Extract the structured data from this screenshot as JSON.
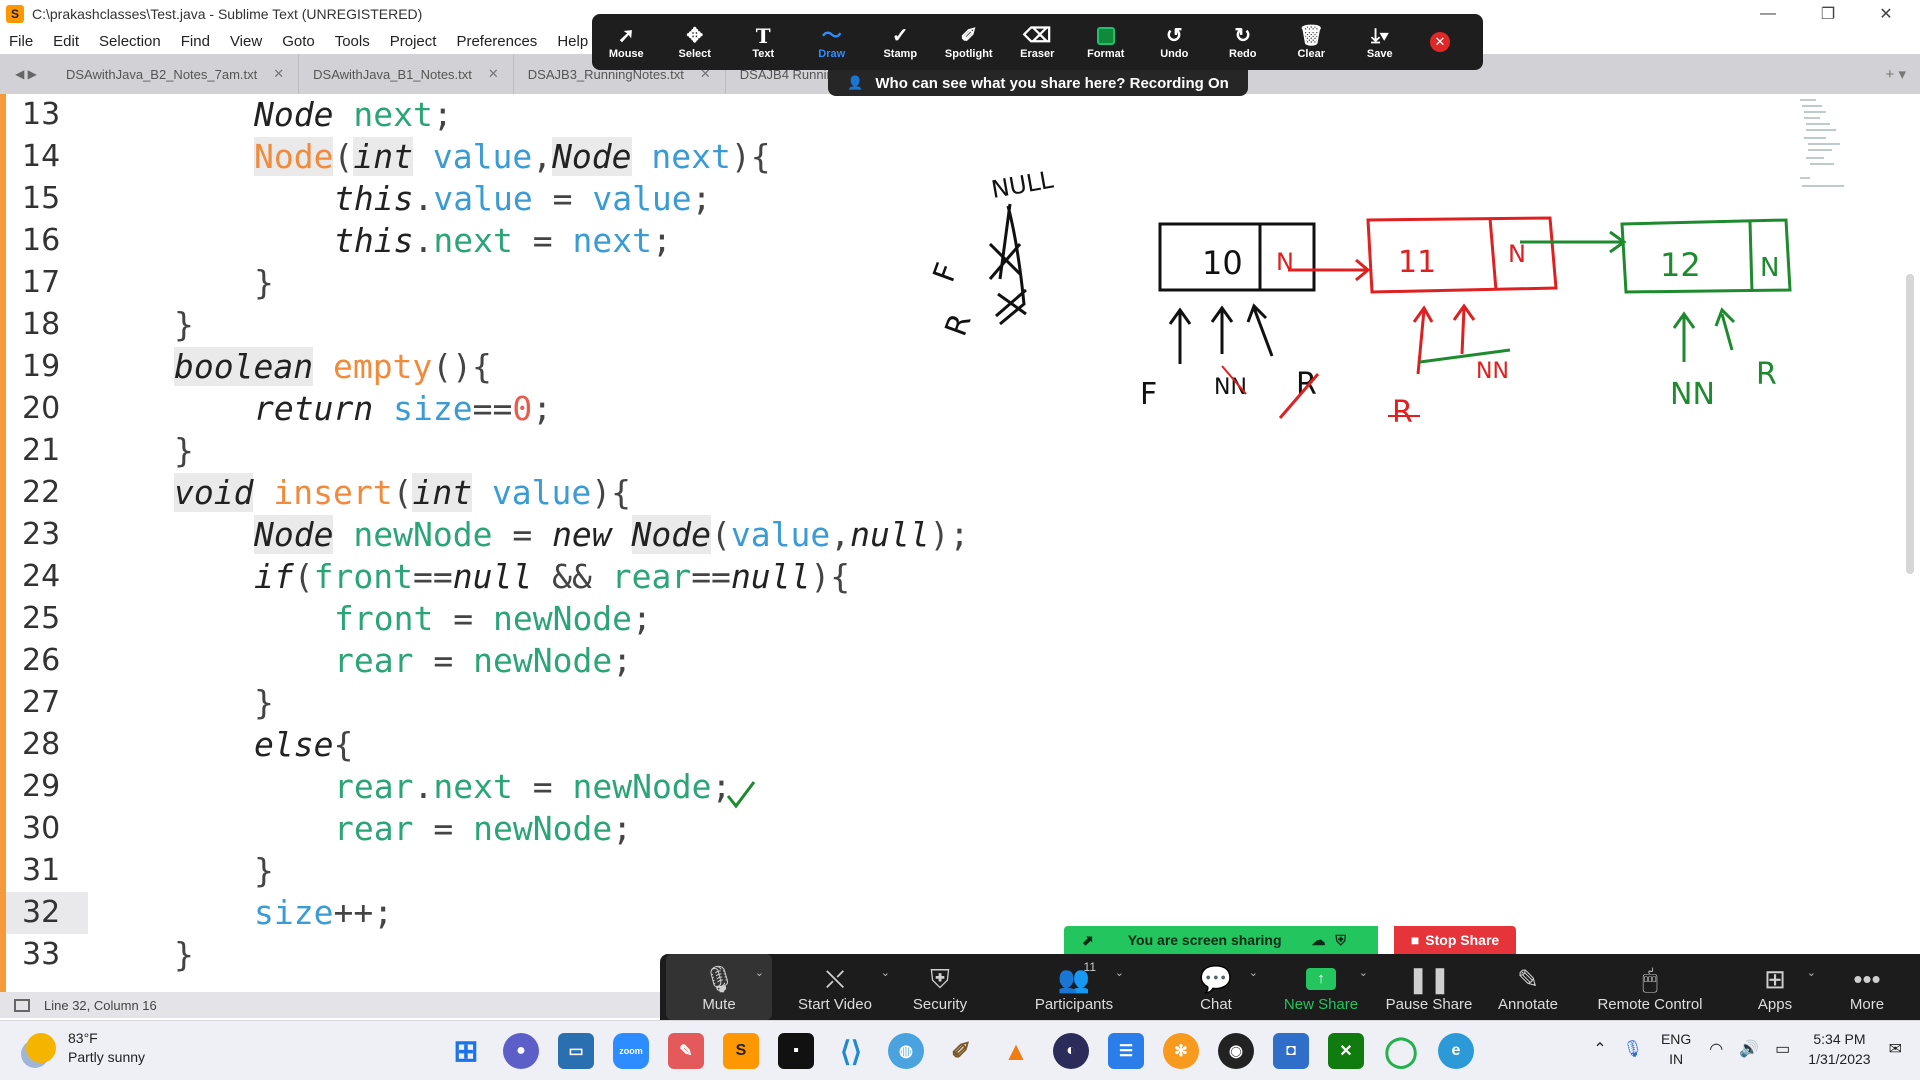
{
  "window": {
    "title": "C:\\prakashclasses\\Test.java - Sublime Text (UNREGISTERED)",
    "controls": [
      "—",
      "❐",
      "✕"
    ]
  },
  "menu": [
    "File",
    "Edit",
    "Selection",
    "Find",
    "View",
    "Goto",
    "Tools",
    "Project",
    "Preferences",
    "Help"
  ],
  "tabs": [
    {
      "label": "DSAwithJava_B2_Notes_7am.txt"
    },
    {
      "label": "DSAwithJava_B1_Notes.txt"
    },
    {
      "label": "DSAJB3_RunningNotes.txt"
    },
    {
      "label": "DSAJB4 Runnin"
    }
  ],
  "code_lines": [
    {
      "num": "13"
    },
    {
      "num": "14"
    },
    {
      "num": "15"
    },
    {
      "num": "16"
    },
    {
      "num": "17"
    },
    {
      "num": "18"
    },
    {
      "num": "19"
    },
    {
      "num": "20"
    },
    {
      "num": "21"
    },
    {
      "num": "22"
    },
    {
      "num": "23"
    },
    {
      "num": "24"
    },
    {
      "num": "25"
    },
    {
      "num": "26"
    },
    {
      "num": "27"
    },
    {
      "num": "28"
    },
    {
      "num": "29"
    },
    {
      "num": "30"
    },
    {
      "num": "31"
    },
    {
      "num": "32"
    },
    {
      "num": "33"
    }
  ],
  "status": {
    "position": "Line 32, Column 16"
  },
  "annotate_toolbar": {
    "tools": [
      "Mouse",
      "Select",
      "Text",
      "Draw",
      "Stamp",
      "Spotlight",
      "Eraser",
      "Format",
      "Undo",
      "Redo",
      "Clear",
      "Save"
    ],
    "active": "Draw",
    "recording_banner": "Who can see what you share here? Recording On"
  },
  "share": {
    "status": "You are screen sharing",
    "stop_label": "Stop Share"
  },
  "zoom_toolbar": {
    "mute": "Mute",
    "start_video": "Start Video",
    "security": "Security",
    "participants": "Participants",
    "participant_count": "11",
    "chat": "Chat",
    "new_share": "New Share",
    "pause_share": "Pause Share",
    "annotate": "Annotate",
    "remote_control": "Remote Control",
    "apps": "Apps",
    "more": "More"
  },
  "drawing": {
    "labels": [
      "NULL",
      "F",
      "R",
      "10",
      "N",
      "11",
      "N",
      "12",
      "N",
      "F",
      "NN",
      "R",
      "NN",
      "R",
      "NN",
      "R"
    ],
    "colors": {
      "black": "#111111",
      "red": "#e02020",
      "green": "#1e8a2e"
    }
  },
  "taskbar": {
    "weather_temp": "83°F",
    "weather_desc": "Partly sunny",
    "language": "ENG",
    "region": "IN",
    "time": "5:34 PM",
    "date": "1/31/2023"
  },
  "colors": {
    "accent_orange": "#f59b3b",
    "zoom_green": "#23c55e",
    "zoom_red": "#e5343a",
    "zoom_blue": "#2d8cff"
  }
}
